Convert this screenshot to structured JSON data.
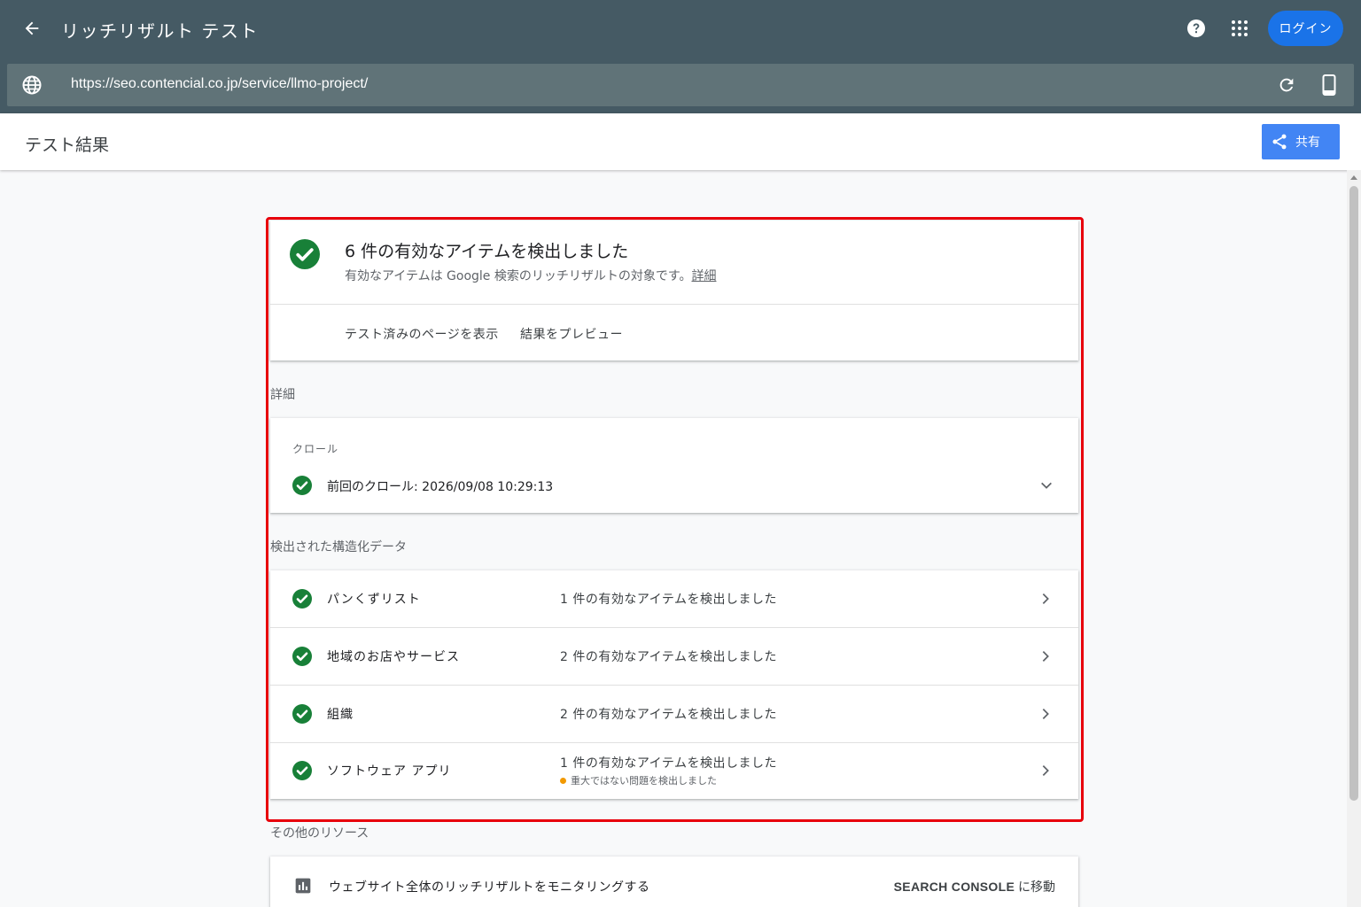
{
  "appbar": {
    "title": "リッチリザルト テスト",
    "login_label": "ログイン",
    "url": "https://seo.contencial.co.jp/service/llmo-project/"
  },
  "subheader": {
    "title": "テスト結果",
    "share_label": "共有"
  },
  "summary": {
    "title": "6 件の有効なアイテムを検出しました",
    "subtitle": "有効なアイテムは Google 検索のリッチリザルトの対象です。",
    "details_link": "詳細",
    "actions": [
      {
        "label": "テスト済みのページを表示"
      },
      {
        "label": "結果をプレビュー"
      }
    ]
  },
  "details_section": {
    "label": "詳細",
    "crawl": {
      "label": "クロール",
      "text": "前回のクロール: 2026/09/08 10:29:13"
    }
  },
  "structured_data": {
    "label": "検出された構造化データ",
    "items": [
      {
        "name": "パンくずリスト",
        "status": "1 件の有効なアイテムを検出しました"
      },
      {
        "name": "地域のお店やサービス",
        "status": "2 件の有効なアイテムを検出しました"
      },
      {
        "name": "組織",
        "status": "2 件の有効なアイテムを検出しました"
      },
      {
        "name": "ソフトウェア アプリ",
        "status": "1 件の有効なアイテムを検出しました",
        "warning": "重大ではない問題を検出しました"
      }
    ]
  },
  "resources": {
    "label": "その他のリソース",
    "item_text": "ウェブサイト全体のリッチリザルトをモニタリングする",
    "link_bold": "SEARCH CONSOLE",
    "link_suffix": " に移動"
  },
  "colors": {
    "appbar": "#455a64",
    "urlbar": "#607378",
    "success": "#188038",
    "warning": "#f29900",
    "primary": "#1a73e8",
    "highlight": "#e8000b"
  },
  "icons": [
    "back-arrow-icon",
    "help-icon",
    "apps-grid-icon",
    "globe-icon",
    "reload-icon",
    "mobile-device-icon",
    "share-icon",
    "check-circle-icon",
    "chevron-down-icon",
    "chevron-right-icon",
    "bar-chart-icon"
  ]
}
